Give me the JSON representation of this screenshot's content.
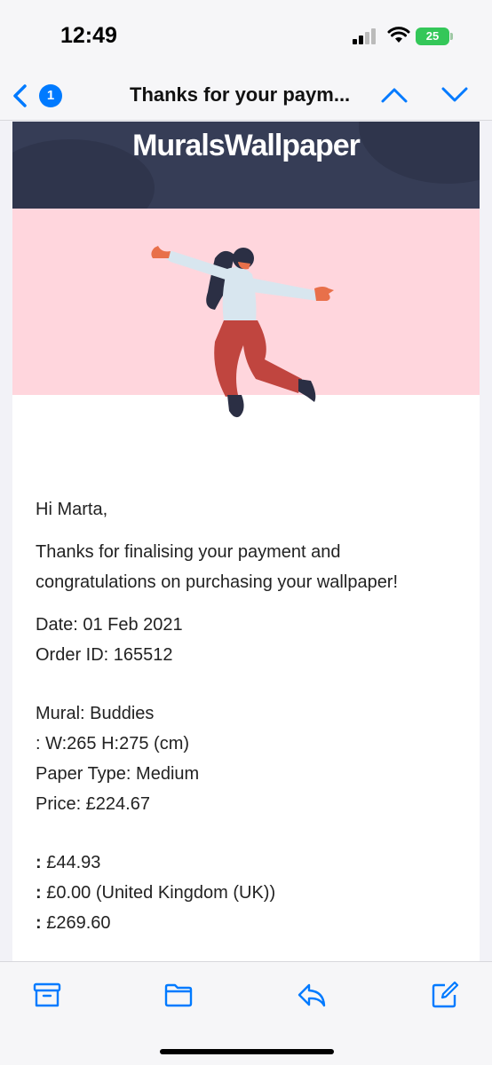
{
  "status_bar": {
    "time": "12:49",
    "battery": "25"
  },
  "nav": {
    "unread_count": "1",
    "title": "Thanks for your paym..."
  },
  "email": {
    "brand": "MuralsWallpaper",
    "greeting": "Hi Marta,",
    "message": "Thanks for finalising your payment and congratulations on purchasing your wallpaper!",
    "date": "Date: 01 Feb 2021",
    "order_id": "Order ID: 165512",
    "mural": "Mural: Buddies",
    "dimensions": ": W:265 H:275 (cm)",
    "paper_type": "Paper Type: Medium",
    "price": "Price: £224.67",
    "totals": [
      {
        "label": ":",
        "value": " £44.93"
      },
      {
        "label": ":",
        "value": " £0.00 (United Kingdom (UK))"
      },
      {
        "label": ":",
        "value": " £269.60"
      }
    ]
  },
  "colors": {
    "accent": "#007aff",
    "brand_bg": "#363d56",
    "hero_bg": "#ffd6dd",
    "battery": "#34c759"
  },
  "icons": {
    "toolbar": [
      "archive-icon",
      "folder-icon",
      "reply-icon",
      "compose-icon"
    ]
  }
}
